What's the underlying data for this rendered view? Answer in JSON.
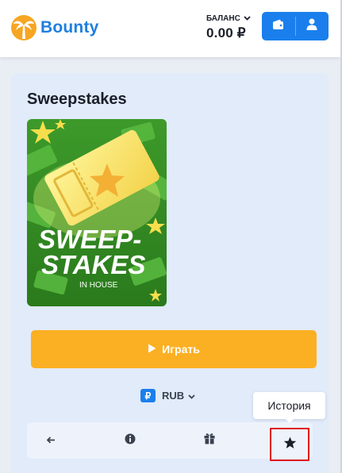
{
  "brand": {
    "name": "Bounty",
    "color": "#1f7fe0"
  },
  "header": {
    "balance_label": "БАЛАНС",
    "balance_value": "0.00 ₽",
    "wallet_icon": "wallet-icon",
    "profile_icon": "user-icon",
    "accent": "#1a7fec"
  },
  "game": {
    "title": "Sweepstakes",
    "image_text_line1": "SWEEP-",
    "image_text_line2": "STAKES",
    "image_subtitle": "IN HOUSE"
  },
  "play_button": {
    "label": "Играть",
    "color": "#fbb023"
  },
  "currency": {
    "symbol": "₽",
    "code": "RUB"
  },
  "tooltip": {
    "text": "История"
  },
  "toolbar": {
    "items": [
      "back-arrow-icon",
      "info-icon",
      "gift-icon",
      "star-icon"
    ],
    "highlight_color": "#e2141c"
  }
}
